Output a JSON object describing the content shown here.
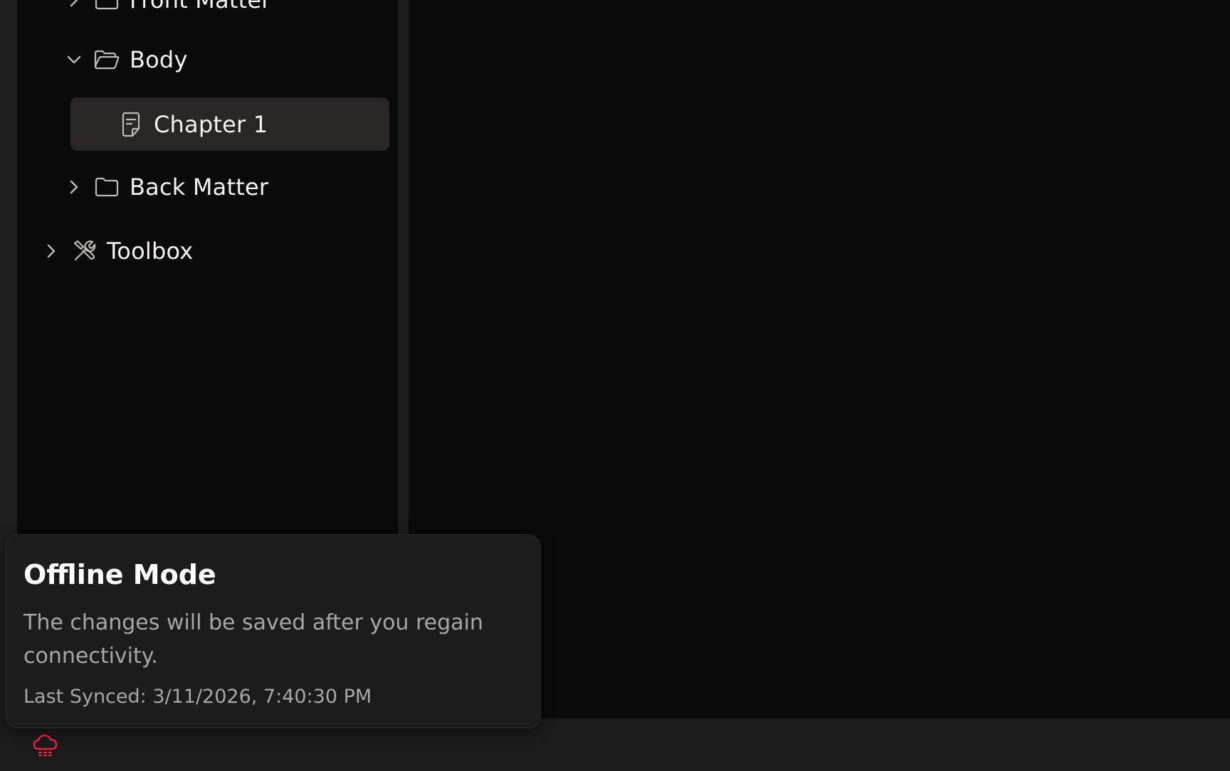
{
  "tree": {
    "front_matter": {
      "label": "Front Matter",
      "expanded": false,
      "icon": "folder-icon"
    },
    "body": {
      "label": "Body",
      "expanded": true,
      "icon": "folder-open-icon"
    },
    "chapter_1": {
      "label": "Chapter 1",
      "selected": true,
      "icon": "document-icon"
    },
    "back_matter": {
      "label": "Back Matter",
      "expanded": false,
      "icon": "folder-icon"
    },
    "toolbox": {
      "label": "Toolbox",
      "expanded": false,
      "icon": "tools-icon"
    }
  },
  "offline_popover": {
    "title": "Offline Mode",
    "message": "The changes will be saved after you regain connectivity.",
    "last_synced": "Last Synced: 3/11/2026, 7:40:30 PM"
  },
  "status": {
    "icon": "cloud-offline-icon",
    "color": "#e8233a"
  },
  "colors": {
    "sidebar_bg": "#0b0a0a",
    "selected_row_bg": "#2a2626",
    "popover_bg": "#1d1c1c",
    "offline_accent": "#e8233a"
  }
}
